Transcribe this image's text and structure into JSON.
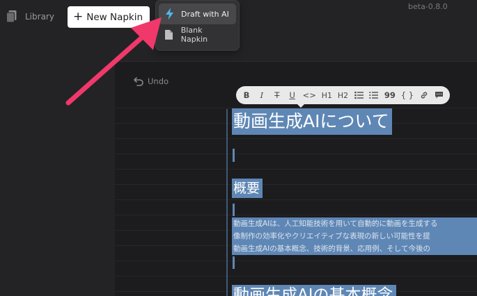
{
  "header": {
    "library_label": "Library",
    "new_napkin_label": "New Napkin",
    "version": "beta-0.8.0"
  },
  "dropdown": {
    "items": [
      {
        "label": "Draft with AI",
        "icon": "lightning-icon",
        "active": true
      },
      {
        "label": "Blank Napkin",
        "icon": "document-icon",
        "active": false
      }
    ]
  },
  "editor": {
    "undo_label": "Undo",
    "toolbar": {
      "bold": "B",
      "italic": "I",
      "strike": "T",
      "underline": "U",
      "code": "<>",
      "h1": "H1",
      "h2": "H2",
      "quote": "99",
      "braces": "{ }"
    },
    "content": {
      "heading1": "動画生成AIについて",
      "heading2": "概要",
      "paragraph_lines": [
        "動画生成AIは、人工知能技術を用いて自動的に動画を生成する",
        "像制作の効率化やクリエイティブな表現の新しい可能性を提",
        "動画生成AIの基本概念、技術的背景、応用例、そして今後の"
      ],
      "heading_bottom": "動画生成AIの基本概念"
    }
  },
  "colors": {
    "background": "#232325",
    "selection": "#5f87b5",
    "accent_bolt": "#4fb8f0",
    "arrow": "#f0386b"
  }
}
